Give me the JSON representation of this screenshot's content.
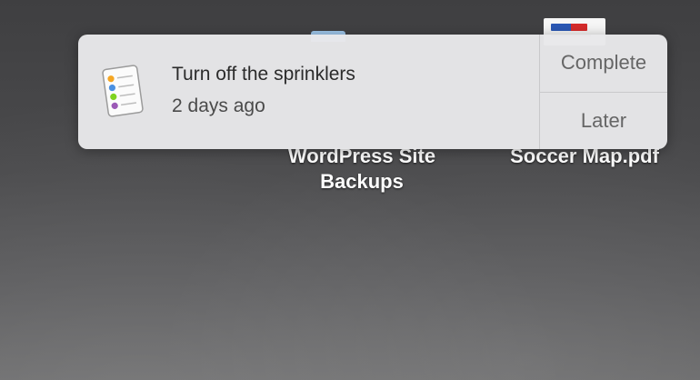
{
  "notification": {
    "app_icon": "reminders-icon",
    "title": "Turn off the sprinklers",
    "subtitle": "2 days ago",
    "actions": {
      "complete_label": "Complete",
      "later_label": "Later"
    }
  },
  "desktop": {
    "icons": [
      {
        "name_line1": "WordPress Site",
        "name_line2": "Backups",
        "icon": "folder-icon"
      },
      {
        "name_line1": "Soccer Map.pdf",
        "icon": "pdf-file-icon"
      }
    ]
  },
  "colors": {
    "notification_bg": "#e8e8ea",
    "desktop_bg": "#4b4b4d",
    "label_text": "#ffffff"
  }
}
